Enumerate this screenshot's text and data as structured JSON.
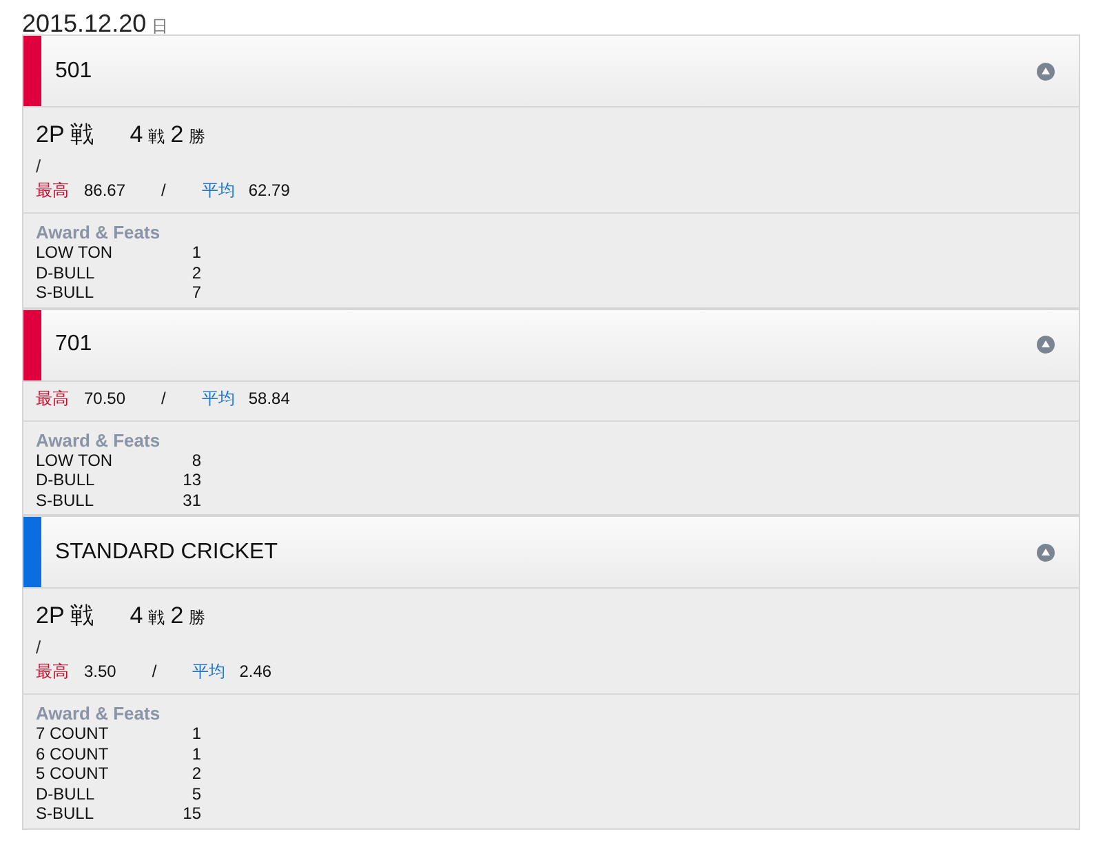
{
  "date": {
    "text": "2015.12.20",
    "weekday": "日"
  },
  "sections": [
    {
      "title": "501",
      "color": "#e0003c",
      "expanded": true,
      "match": {
        "type": "2P 戦",
        "games": "4",
        "games_unit": "戦",
        "wins": "2",
        "wins_unit": "勝",
        "note": "/"
      },
      "stats": {
        "best_label": "最高",
        "best": "86.67",
        "separator": "/",
        "avg_label": "平均",
        "avg": "62.79"
      },
      "feats_title": "Award & Feats",
      "feats": [
        {
          "name": "LOW TON",
          "value": "1"
        },
        {
          "name": "D-BULL",
          "value": "2"
        },
        {
          "name": "S-BULL",
          "value": "7"
        }
      ]
    },
    {
      "title": "701",
      "color": "#e0003c",
      "expanded": true,
      "stats": {
        "best_label": "最高",
        "best": "70.50",
        "separator": "/",
        "avg_label": "平均",
        "avg": "58.84"
      },
      "feats_title": "Award & Feats",
      "feats": [
        {
          "name": "LOW TON",
          "value": "8"
        },
        {
          "name": "D-BULL",
          "value": "13"
        },
        {
          "name": "S-BULL",
          "value": "31"
        }
      ]
    },
    {
      "title": "STANDARD CRICKET",
      "color": "#0a6ee0",
      "expanded": true,
      "match": {
        "type": "2P 戦",
        "games": "4",
        "games_unit": "戦",
        "wins": "2",
        "wins_unit": "勝",
        "note": "/"
      },
      "stats": {
        "best_label": "最高",
        "best": "3.50",
        "separator": "/",
        "avg_label": "平均",
        "avg": "2.46"
      },
      "feats_title": "Award & Feats",
      "feats": [
        {
          "name": "7 COUNT",
          "value": "1"
        },
        {
          "name": "6 COUNT",
          "value": "1"
        },
        {
          "name": "5 COUNT",
          "value": "2"
        },
        {
          "name": "D-BULL",
          "value": "5"
        },
        {
          "name": "S-BULL",
          "value": "15"
        }
      ]
    }
  ]
}
